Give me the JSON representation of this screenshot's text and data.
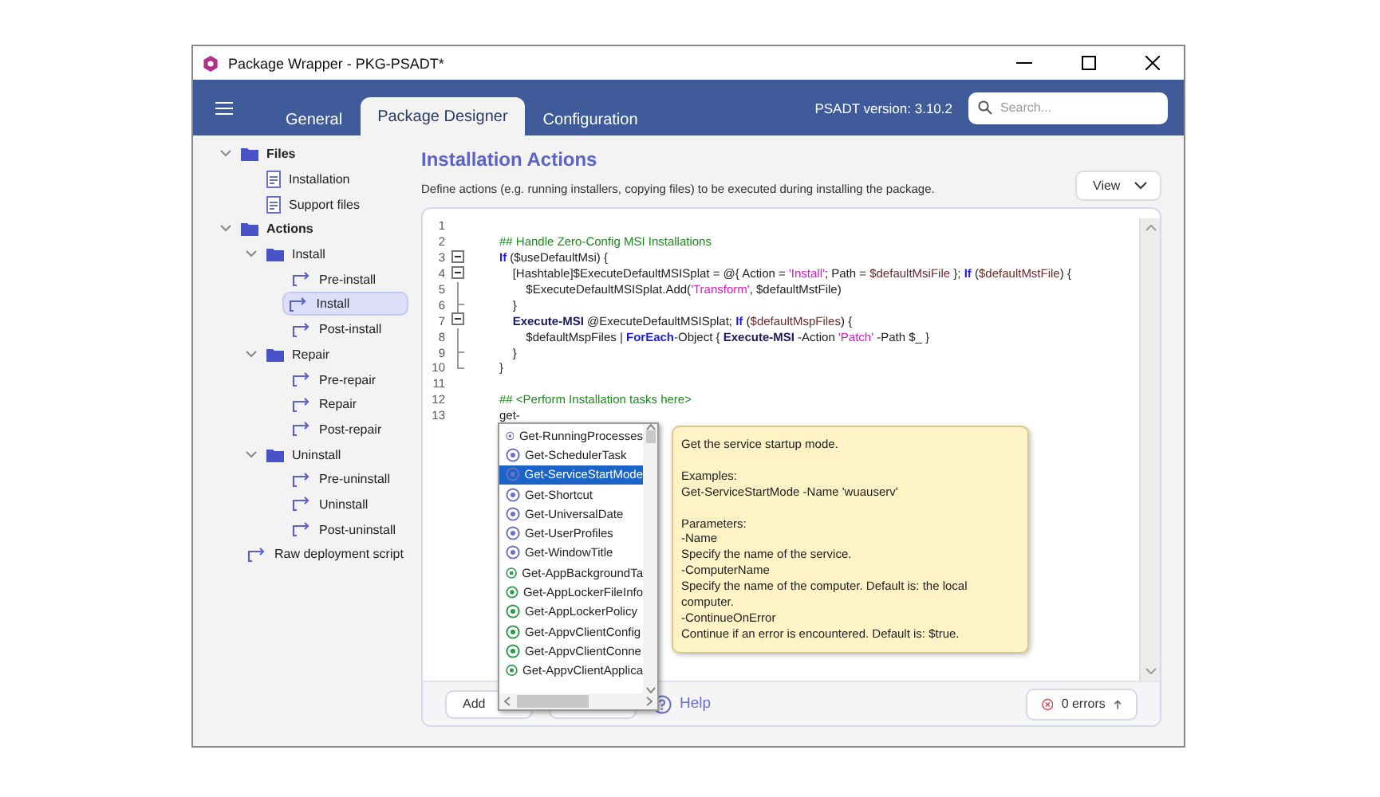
{
  "window": {
    "title": "Package Wrapper - PKG-PSADT*"
  },
  "tabs": [
    {
      "label": "General",
      "selected": false
    },
    {
      "label": "Package Designer",
      "selected": true
    },
    {
      "label": "Configuration",
      "selected": false
    }
  ],
  "version": "PSADT version: 3.10.2",
  "search": {
    "placeholder": "Search..."
  },
  "sidebar": {
    "items": [
      {
        "label": "Files",
        "kind": "folder",
        "expanded": true,
        "selected": false,
        "children": [
          {
            "label": "Installation",
            "kind": "file",
            "selected": false
          },
          {
            "label": "Support files",
            "kind": "file",
            "selected": false
          }
        ]
      },
      {
        "label": "Actions",
        "kind": "folder",
        "expanded": true,
        "selected": false,
        "children": [
          {
            "label": "Install",
            "kind": "folder",
            "expanded": true,
            "selected": false,
            "children": [
              {
                "label": "Pre-install",
                "kind": "action",
                "selected": false
              },
              {
                "label": "Install",
                "kind": "action",
                "selected": true
              },
              {
                "label": "Post-install",
                "kind": "action",
                "selected": false
              }
            ]
          },
          {
            "label": "Repair",
            "kind": "folder",
            "expanded": true,
            "selected": false,
            "children": [
              {
                "label": "Pre-repair",
                "kind": "action",
                "selected": false
              },
              {
                "label": "Repair",
                "kind": "action",
                "selected": false
              },
              {
                "label": "Post-repair",
                "kind": "action",
                "selected": false
              }
            ]
          },
          {
            "label": "Uninstall",
            "kind": "folder",
            "expanded": true,
            "selected": false,
            "children": [
              {
                "label": "Pre-uninstall",
                "kind": "action",
                "selected": false
              },
              {
                "label": "Uninstall",
                "kind": "action",
                "selected": false
              },
              {
                "label": "Post-uninstall",
                "kind": "action",
                "selected": false
              }
            ]
          },
          {
            "label": "Raw deployment script",
            "kind": "action",
            "selected": false
          }
        ]
      }
    ]
  },
  "heading": "Installation Actions",
  "description": "Define actions (e.g. running installers, copying files) to be executed during installing the package.",
  "view_button": "View",
  "editor": {
    "lines": [
      {
        "number": "1",
        "kind": "plain"
      },
      {
        "number": "2",
        "kind": "plain",
        "tokens": [
          {
            "kind": "comment",
            "text": "## Handle Zero-Config MSI Installations"
          }
        ]
      },
      {
        "number": "3",
        "kind": "fold-start",
        "tokens": [
          {
            "kind": "keyword",
            "text": "If"
          },
          {
            "kind": "plain",
            "text": " ($useDefaultMsi) {"
          }
        ]
      },
      {
        "number": "4",
        "kind": "fold-start",
        "tokens": [
          {
            "kind": "plain",
            "text": "    [Hashtable]$ExecuteDefaultMSISplat = @{ Action = "
          },
          {
            "kind": "string",
            "text": "'Install'"
          },
          {
            "kind": "plain",
            "text": "; Path = "
          },
          {
            "kind": "variable",
            "text": "$defaultMsiFile"
          },
          {
            "kind": "plain",
            "text": " }; "
          },
          {
            "kind": "keyword",
            "text": "If"
          },
          {
            "kind": "plain",
            "text": " ("
          },
          {
            "kind": "variable",
            "text": "$defaultMstFile"
          },
          {
            "kind": "plain",
            "text": ") {"
          }
        ]
      },
      {
        "number": "5",
        "kind": "fold-inner",
        "tokens": [
          {
            "kind": "plain",
            "text": "        $ExecuteDefaultMSISplat.Add("
          },
          {
            "kind": "string",
            "text": "'Transform'"
          },
          {
            "kind": "plain",
            "text": ", $defaultMstFile)"
          }
        ]
      },
      {
        "number": "6",
        "kind": "fold-end",
        "tokens": [
          {
            "kind": "plain",
            "text": "    }"
          }
        ]
      },
      {
        "number": "7",
        "kind": "fold-start",
        "tokens": [
          {
            "kind": "command",
            "text": "    Execute-MSI"
          },
          {
            "kind": "plain",
            "text": " @ExecuteDefaultMSISplat; "
          },
          {
            "kind": "keyword",
            "text": "If"
          },
          {
            "kind": "plain",
            "text": " ("
          },
          {
            "kind": "variable",
            "text": "$defaultMspFiles"
          },
          {
            "kind": "plain",
            "text": ") {"
          }
        ]
      },
      {
        "number": "8",
        "kind": "fold-inner",
        "tokens": [
          {
            "kind": "plain",
            "text": "        $defaultMspFiles | "
          },
          {
            "kind": "keyword",
            "text": "ForEach"
          },
          {
            "kind": "plain",
            "text": "-Object { "
          },
          {
            "kind": "command",
            "text": "Execute-MSI"
          },
          {
            "kind": "plain",
            "text": " -Action "
          },
          {
            "kind": "string",
            "text": "'Patch'"
          },
          {
            "kind": "plain",
            "text": " -Path $_ }"
          }
        ]
      },
      {
        "number": "9",
        "kind": "fold-end",
        "tokens": [
          {
            "kind": "plain",
            "text": "    }"
          }
        ]
      },
      {
        "number": "10",
        "kind": "fold-last",
        "tokens": [
          {
            "kind": "plain",
            "text": "}"
          }
        ]
      },
      {
        "number": "11",
        "kind": "plain"
      },
      {
        "number": "12",
        "kind": "plain",
        "tokens": [
          {
            "kind": "comment",
            "text": "## <Perform Installation tasks here>"
          }
        ]
      },
      {
        "number": "13",
        "kind": "plain",
        "tokens": [
          {
            "kind": "plain",
            "text": "get-"
          }
        ]
      }
    ]
  },
  "completion": {
    "items": [
      {
        "label": "Get-RunningProcesses",
        "kind": "toolkit",
        "selected": false
      },
      {
        "label": "Get-SchedulerTask",
        "kind": "toolkit",
        "selected": false
      },
      {
        "label": "Get-ServiceStartMode",
        "kind": "toolkit",
        "selected": true
      },
      {
        "label": "Get-Shortcut",
        "kind": "toolkit",
        "selected": false
      },
      {
        "label": "Get-UniversalDate",
        "kind": "toolkit",
        "selected": false
      },
      {
        "label": "Get-UserProfiles",
        "kind": "toolkit",
        "selected": false
      },
      {
        "label": "Get-WindowTitle",
        "kind": "toolkit",
        "selected": false
      },
      {
        "label": "Get-AppBackgroundTa",
        "kind": "cmdlet",
        "selected": false
      },
      {
        "label": "Get-AppLockerFileInfo",
        "kind": "cmdlet",
        "selected": false
      },
      {
        "label": "Get-AppLockerPolicy",
        "kind": "cmdlet",
        "selected": false
      },
      {
        "label": "Get-AppvClientConfig",
        "kind": "cmdlet",
        "selected": false
      },
      {
        "label": "Get-AppvClientConne",
        "kind": "cmdlet",
        "selected": false
      },
      {
        "label": "Get-AppvClientApplica",
        "kind": "cmdlet",
        "selected": false
      }
    ]
  },
  "tooltip": {
    "paragraphs": [
      [
        "Get the service startup mode."
      ],
      [
        "Examples:",
        "Get-ServiceStartMode -Name 'wuauserv'"
      ],
      [
        "Parameters:",
        "-Name",
        "Specify the name of the service.",
        "-ComputerName",
        "Specify the name of the computer. Default is: the local computer.",
        "-ContinueOnError",
        "Continue if an error is encountered. Default is: $true."
      ]
    ]
  },
  "footer": {
    "add_button": "Add",
    "help_link": "Help",
    "errors_button": "0 errors"
  }
}
